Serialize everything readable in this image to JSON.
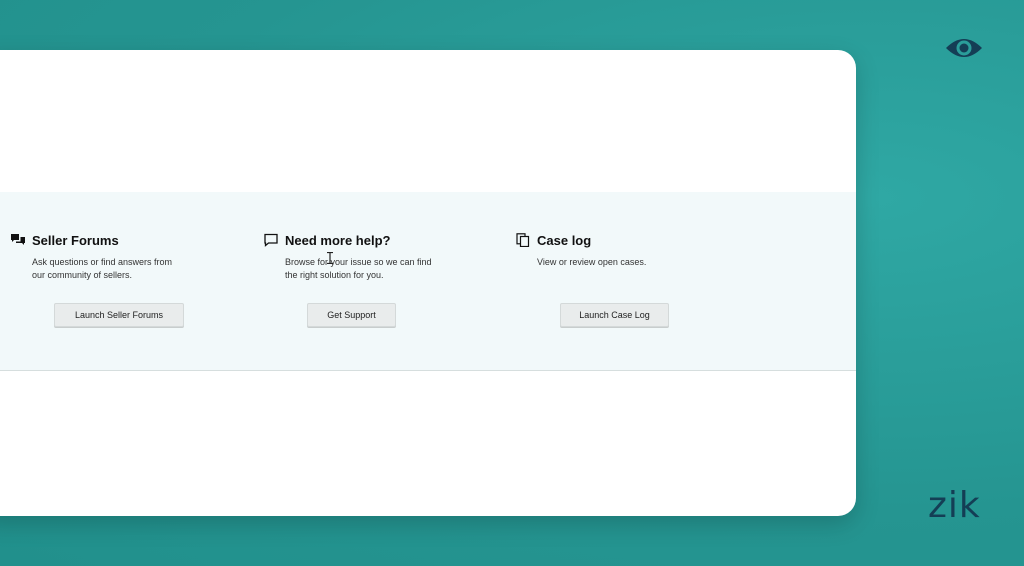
{
  "brand": {
    "logo_text": "zik"
  },
  "icons": {
    "watermark": "eye-icon",
    "forums": "chat-bubbles-icon",
    "help": "speech-bubble-icon",
    "caselog": "copy-pages-icon",
    "cursor": "text-cursor-icon"
  },
  "colors": {
    "background": "#2a9d9a",
    "brand_dark": "#143e55",
    "band": "#f2f9fa",
    "button": "#e9ecec"
  },
  "help": {
    "sections": [
      {
        "title": "Seller Forums",
        "description": "Ask questions or find answers from our community of sellers.",
        "button": "Launch Seller Forums"
      },
      {
        "title": "Need more help?",
        "description": "Browse for your issue so we can find the right solution for you.",
        "button": "Get Support"
      },
      {
        "title": "Case log",
        "description": "View or review open cases.",
        "button": "Launch Case Log"
      }
    ]
  }
}
